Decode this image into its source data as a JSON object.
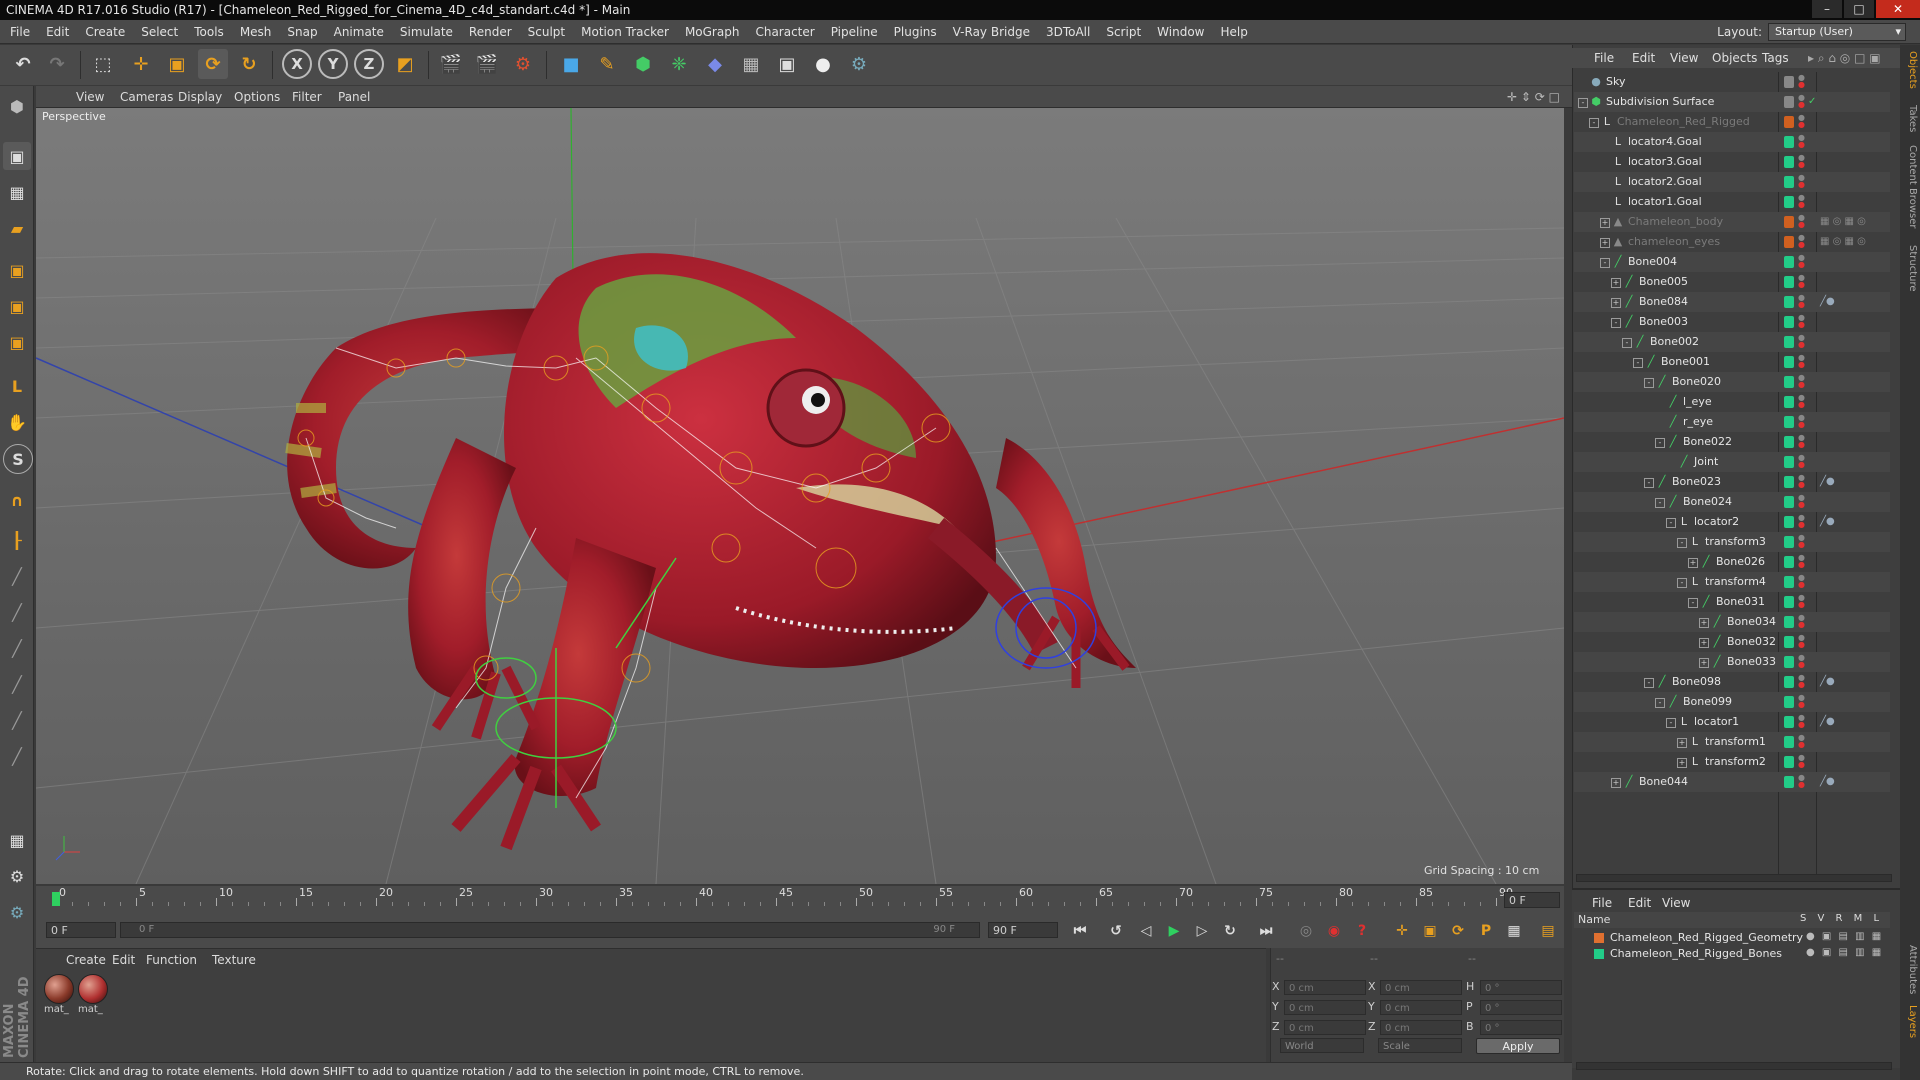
{
  "window": {
    "title": "CINEMA 4D R17.016 Studio (R17) - [Chameleon_Red_Rigged_for_Cinema_4D_c4d_standart.c4d *] - Main",
    "minimize": "–",
    "maximize": "□",
    "close": "✕"
  },
  "menubar": {
    "items": [
      "File",
      "Edit",
      "Create",
      "Select",
      "Tools",
      "Mesh",
      "Snap",
      "Animate",
      "Simulate",
      "Render",
      "Sculpt",
      "Motion Tracker",
      "MoGraph",
      "Character",
      "Pipeline",
      "Plugins",
      "V-Ray Bridge",
      "3DToAll",
      "Script",
      "Window",
      "Help"
    ],
    "layout_label": "Layout:",
    "layout_value": "Startup (User)"
  },
  "toolbar": {
    "axis_x": "X",
    "axis_y": "Y",
    "axis_z": "Z"
  },
  "viewport": {
    "menu": [
      "View",
      "Cameras",
      "Display",
      "Options",
      "Filter",
      "Panel"
    ],
    "camera_label": "Perspective",
    "grid_spacing": "Grid Spacing : 10 cm"
  },
  "timeline": {
    "ticks": [
      "0",
      "5",
      "10",
      "15",
      "20",
      "25",
      "30",
      "35",
      "40",
      "45",
      "50",
      "55",
      "60",
      "65",
      "70",
      "75",
      "80",
      "85",
      "90"
    ],
    "current_frame_field": "0 F",
    "start_field": "0 F",
    "slider_start": "0 F",
    "slider_end": "90 F",
    "end_field": "90 F"
  },
  "material_manager": {
    "menu": [
      "Create",
      "Edit",
      "Function",
      "Texture"
    ],
    "materials": [
      {
        "label": "mat_",
        "color": "#8a3a2a"
      },
      {
        "label": "mat_",
        "color": "#b03030"
      }
    ]
  },
  "coordinates": {
    "header_left": "--",
    "header_mid": "--",
    "header_right": "--",
    "rows": [
      {
        "a": "X",
        "av": "0 cm",
        "b": "X",
        "bv": "0 cm",
        "c": "H",
        "cv": "0 °"
      },
      {
        "a": "Y",
        "av": "0 cm",
        "b": "Y",
        "bv": "0 cm",
        "c": "P",
        "cv": "0 °"
      },
      {
        "a": "Z",
        "av": "0 cm",
        "b": "Z",
        "bv": "0 cm",
        "c": "B",
        "cv": "0 °"
      }
    ],
    "space_select": "World",
    "mode_select": "Scale",
    "apply_label": "Apply"
  },
  "status": {
    "text": "Rotate: Click and drag to rotate elements. Hold down SHIFT to add to quantize rotation / add to the selection in point mode, CTRL to remove."
  },
  "object_manager": {
    "menu": [
      "File",
      "Edit",
      "View",
      "Objects",
      "Tags"
    ],
    "rows": [
      {
        "name": "Sky",
        "indent": 0,
        "exp": "",
        "icon": "sky",
        "dim": false,
        "vis": "#888"
      },
      {
        "name": "Subdivision Surface",
        "indent": 0,
        "exp": "-",
        "icon": "subd",
        "dim": false,
        "vis": "#888"
      },
      {
        "name": "Chameleon_Red_Rigged",
        "indent": 1,
        "exp": "-",
        "icon": "null",
        "dim": true,
        "vis": "#d06020"
      },
      {
        "name": "locator4.Goal",
        "indent": 2,
        "exp": "",
        "icon": "null",
        "dim": false,
        "vis": "#22cc88"
      },
      {
        "name": "locator3.Goal",
        "indent": 2,
        "exp": "",
        "icon": "null",
        "dim": false,
        "vis": "#22cc88"
      },
      {
        "name": "locator2.Goal",
        "indent": 2,
        "exp": "",
        "icon": "null",
        "dim": false,
        "vis": "#22cc88"
      },
      {
        "name": "locator1.Goal",
        "indent": 2,
        "exp": "",
        "icon": "null",
        "dim": false,
        "vis": "#22cc88"
      },
      {
        "name": "Chameleon_body",
        "indent": 2,
        "exp": "+",
        "icon": "poly",
        "dim": true,
        "vis": "#d06020"
      },
      {
        "name": "chameleon_eyes",
        "indent": 2,
        "exp": "+",
        "icon": "poly",
        "dim": true,
        "vis": "#d06020"
      },
      {
        "name": "Bone004",
        "indent": 2,
        "exp": "-",
        "icon": "bone",
        "dim": false,
        "vis": "#22cc88"
      },
      {
        "name": "Bone005",
        "indent": 3,
        "exp": "+",
        "icon": "bone",
        "dim": false,
        "vis": "#22cc88"
      },
      {
        "name": "Bone084",
        "indent": 3,
        "exp": "+",
        "icon": "bone",
        "dim": false,
        "vis": "#22cc88",
        "tag": true
      },
      {
        "name": "Bone003",
        "indent": 3,
        "exp": "-",
        "icon": "bone",
        "dim": false,
        "vis": "#22cc88"
      },
      {
        "name": "Bone002",
        "indent": 4,
        "exp": "-",
        "icon": "bone",
        "dim": false,
        "vis": "#22cc88"
      },
      {
        "name": "Bone001",
        "indent": 5,
        "exp": "-",
        "icon": "bone",
        "dim": false,
        "vis": "#22cc88"
      },
      {
        "name": "Bone020",
        "indent": 6,
        "exp": "-",
        "icon": "bone",
        "dim": false,
        "vis": "#22cc88"
      },
      {
        "name": "l_eye",
        "indent": 7,
        "exp": "",
        "icon": "bone",
        "dim": false,
        "vis": "#22cc88"
      },
      {
        "name": "r_eye",
        "indent": 7,
        "exp": "",
        "icon": "bone",
        "dim": false,
        "vis": "#22cc88"
      },
      {
        "name": "Bone022",
        "indent": 7,
        "exp": "-",
        "icon": "bone",
        "dim": false,
        "vis": "#22cc88"
      },
      {
        "name": "Joint",
        "indent": 8,
        "exp": "",
        "icon": "bone",
        "dim": false,
        "vis": "#22cc88"
      },
      {
        "name": "Bone023",
        "indent": 6,
        "exp": "-",
        "icon": "bone",
        "dim": false,
        "vis": "#22cc88",
        "tag": true
      },
      {
        "name": "Bone024",
        "indent": 7,
        "exp": "-",
        "icon": "bone",
        "dim": false,
        "vis": "#22cc88"
      },
      {
        "name": "locator2",
        "indent": 8,
        "exp": "-",
        "icon": "null",
        "dim": false,
        "vis": "#22cc88",
        "tag": true
      },
      {
        "name": "transform3",
        "indent": 9,
        "exp": "-",
        "icon": "null",
        "dim": false,
        "vis": "#22cc88"
      },
      {
        "name": "Bone026",
        "indent": 10,
        "exp": "+",
        "icon": "bone",
        "dim": false,
        "vis": "#22cc88"
      },
      {
        "name": "transform4",
        "indent": 9,
        "exp": "-",
        "icon": "null",
        "dim": false,
        "vis": "#22cc88"
      },
      {
        "name": "Bone031",
        "indent": 10,
        "exp": "-",
        "icon": "bone",
        "dim": false,
        "vis": "#22cc88"
      },
      {
        "name": "Bone034",
        "indent": 11,
        "exp": "+",
        "icon": "bone",
        "dim": false,
        "vis": "#22cc88"
      },
      {
        "name": "Bone032",
        "indent": 11,
        "exp": "+",
        "icon": "bone",
        "dim": false,
        "vis": "#22cc88"
      },
      {
        "name": "Bone033",
        "indent": 11,
        "exp": "+",
        "icon": "bone",
        "dim": false,
        "vis": "#22cc88"
      },
      {
        "name": "Bone098",
        "indent": 6,
        "exp": "-",
        "icon": "bone",
        "dim": false,
        "vis": "#22cc88",
        "tag": true
      },
      {
        "name": "Bone099",
        "indent": 7,
        "exp": "-",
        "icon": "bone",
        "dim": false,
        "vis": "#22cc88"
      },
      {
        "name": "locator1",
        "indent": 8,
        "exp": "-",
        "icon": "null",
        "dim": false,
        "vis": "#22cc88",
        "tag": true
      },
      {
        "name": "transform1",
        "indent": 9,
        "exp": "+",
        "icon": "null",
        "dim": false,
        "vis": "#22cc88"
      },
      {
        "name": "transform2",
        "indent": 9,
        "exp": "+",
        "icon": "null",
        "dim": false,
        "vis": "#22cc88"
      },
      {
        "name": "Bone044",
        "indent": 3,
        "exp": "+",
        "icon": "bone",
        "dim": false,
        "vis": "#22cc88",
        "tag": true
      }
    ]
  },
  "layer_manager": {
    "menu": [
      "File",
      "Edit",
      "View"
    ],
    "header_name": "Name",
    "header_flags": "S V R M L",
    "layers": [
      {
        "name": "Chameleon_Red_Rigged_Geometry",
        "color": "#e07030"
      },
      {
        "name": "Chameleon_Red_Rigged_Bones",
        "color": "#22cc88"
      }
    ]
  },
  "side_tabs": [
    "Objects",
    "Takes",
    "Content Browser",
    "Structure",
    "Attributes",
    "Layers"
  ]
}
